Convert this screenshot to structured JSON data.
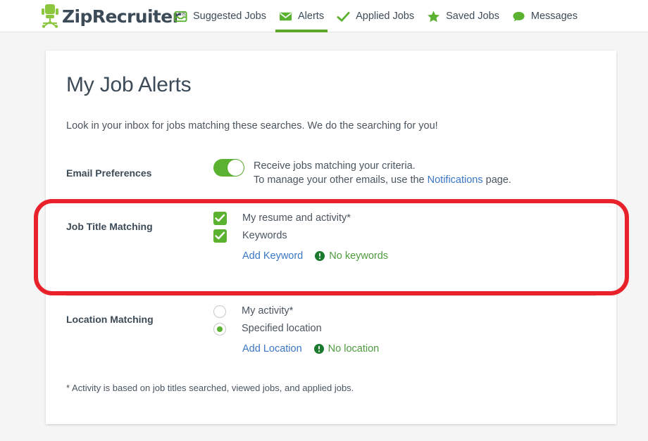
{
  "brand": {
    "name": "ZipRecruiter",
    "registered_mark": "®",
    "logo_icon": "office-chair-icon",
    "logo_color": "#8cc63f"
  },
  "nav": {
    "items": [
      {
        "label": "Suggested Jobs",
        "icon": "inbox-tray-icon",
        "active": false
      },
      {
        "label": "Alerts",
        "icon": "envelope-icon",
        "active": true
      },
      {
        "label": "Applied Jobs",
        "icon": "check-mark-icon",
        "active": false
      },
      {
        "label": "Saved Jobs",
        "icon": "star-icon",
        "active": false
      },
      {
        "label": "Messages",
        "icon": "speech-bubble-icon",
        "active": false
      }
    ],
    "active_indicator_color": "#5ba829"
  },
  "page": {
    "title": "My Job Alerts",
    "description": "Look in your inbox for jobs matching these searches. We do the searching for you!",
    "footnote": "* Activity is based on job titles searched, viewed jobs, and applied jobs."
  },
  "email_preferences": {
    "label": "Email Preferences",
    "toggle": {
      "state": "on",
      "name": "receive-jobs-toggle",
      "on_color": "#5bb130"
    },
    "line1": "Receive jobs matching your criteria.",
    "line2_before": "To manage your other emails, use the ",
    "line2_link": "Notifications",
    "line2_after": " page."
  },
  "job_title_matching": {
    "label": "Job Title Matching",
    "options": [
      {
        "label": "My resume and activity*",
        "checked": true,
        "control": "checkbox"
      },
      {
        "label": "Keywords",
        "checked": true,
        "control": "checkbox"
      }
    ],
    "action_link": "Add Keyword",
    "status_icon": "exclamation-circle-icon",
    "status_text": "No keywords",
    "status_color": "#4e9a3e"
  },
  "location_matching": {
    "label": "Location Matching",
    "options": [
      {
        "label": "My activity*",
        "checked": false,
        "control": "radio"
      },
      {
        "label": "Specified location",
        "checked": true,
        "control": "radio"
      }
    ],
    "action_link": "Add Location",
    "status_icon": "exclamation-circle-icon",
    "status_text": "No location",
    "status_color": "#4e9a3e"
  },
  "annotation": {
    "shape": "rounded-rectangle",
    "color": "#e8212a",
    "target": "job-title-matching-section"
  },
  "colors": {
    "brand_green": "#5bb130",
    "link_blue": "#3a76c4",
    "text_dark": "#3d4b58",
    "page_background": "#f5f5f5",
    "card_background": "#ffffff"
  }
}
